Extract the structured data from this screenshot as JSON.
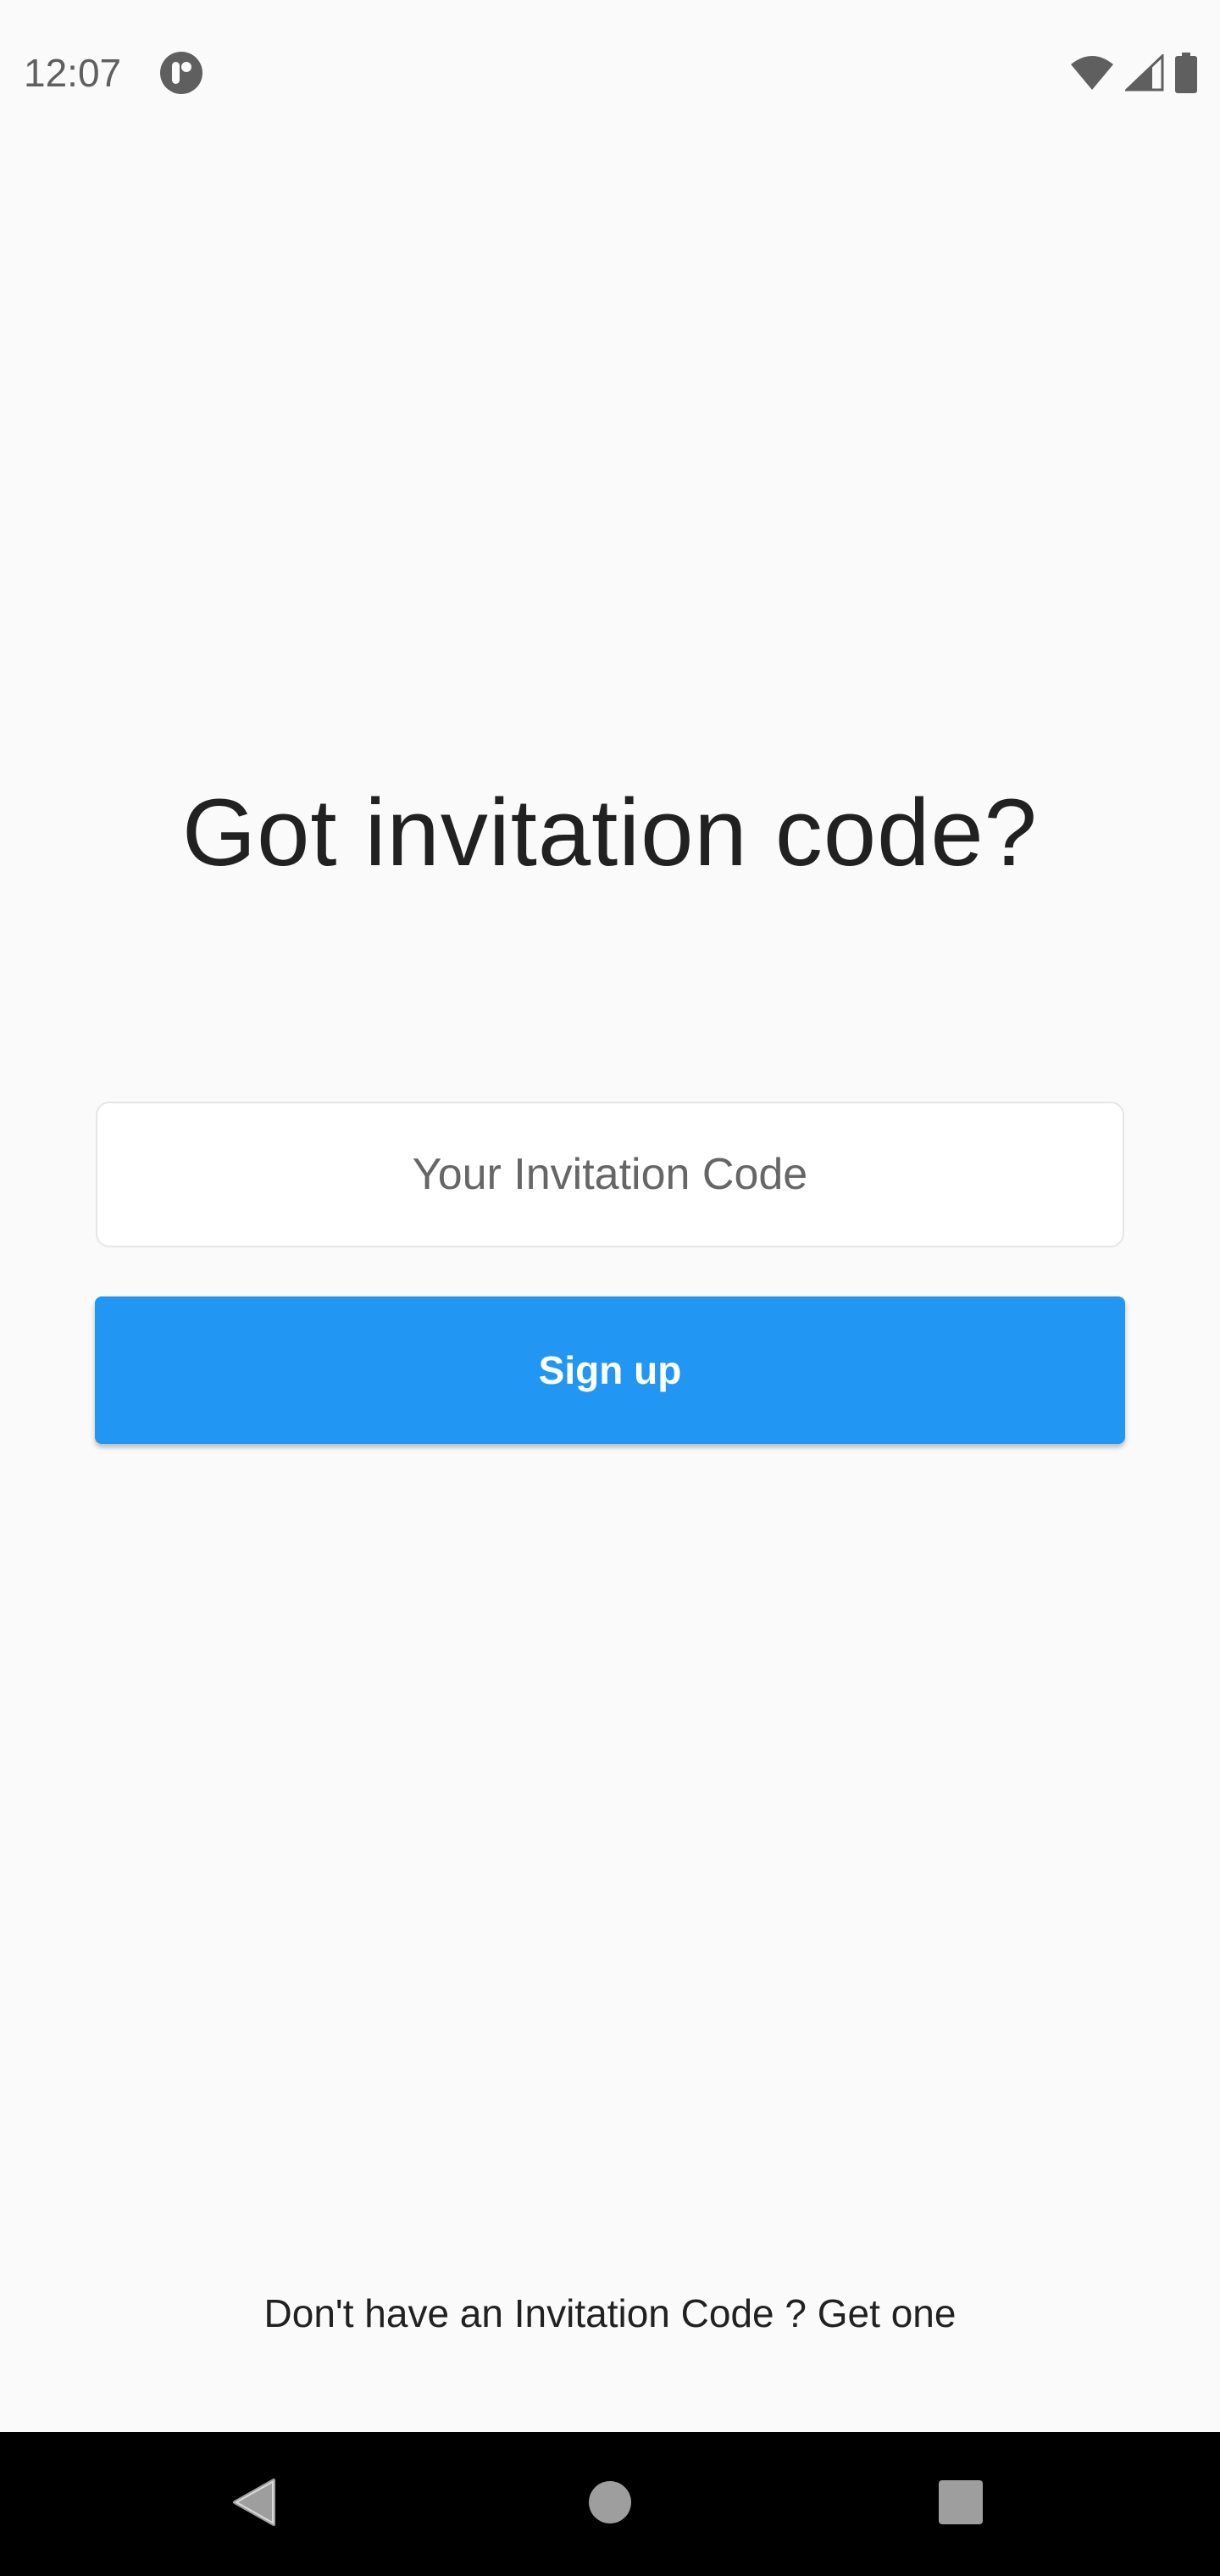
{
  "status_bar": {
    "time": "12:07",
    "app_icon": "circle-app-notification-icon",
    "wifi_icon": "wifi-icon",
    "signal_icon": "cell-signal-icon",
    "battery_icon": "battery-icon"
  },
  "main": {
    "title": "Got invitation code?",
    "input": {
      "placeholder": "Your Invitation Code",
      "value": ""
    },
    "signup_label": "Sign up",
    "footer_prefix": "Don't have an Invitation Code ? ",
    "footer_link": "Get one"
  },
  "nav_bar": {
    "back_icon": "back-triangle-icon",
    "home_icon": "home-circle-icon",
    "recents_icon": "recents-square-icon"
  },
  "colors": {
    "background": "#fafafa",
    "accent": "#2196f3",
    "text": "#212121",
    "nav_bar": "#000000"
  }
}
